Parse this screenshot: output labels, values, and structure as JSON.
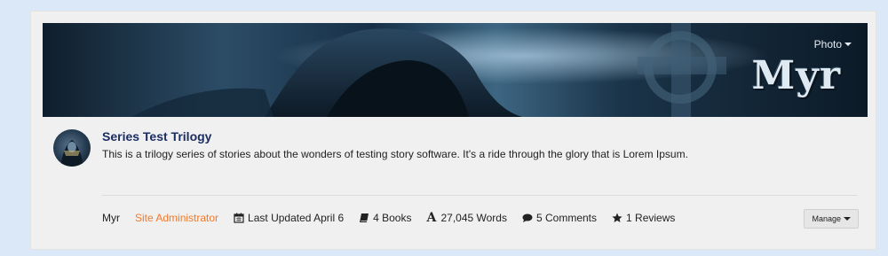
{
  "banner": {
    "photo_label": "Photo",
    "brand_text": "Myr"
  },
  "series": {
    "title": "Series Test Trilogy",
    "description": "This is a trilogy series of stories about the wonders of testing story software. It's a ride through the glory that is Lorem Ipsum."
  },
  "meta": {
    "author": "Myr",
    "role": "Site Administrator",
    "last_updated": "Last Updated April 6",
    "books": "4 Books",
    "words": "27,045 Words",
    "comments": "5 Comments",
    "reviews": "1 Reviews"
  },
  "actions": {
    "manage_label": "Manage"
  },
  "colors": {
    "page_bg": "#dbe8f7",
    "title": "#1b2d63",
    "role": "#f07a2d"
  },
  "icons": {
    "last_updated": "calendar-icon",
    "books": "book-icon",
    "words": "font-icon",
    "comments": "comment-icon",
    "reviews": "star-icon"
  }
}
